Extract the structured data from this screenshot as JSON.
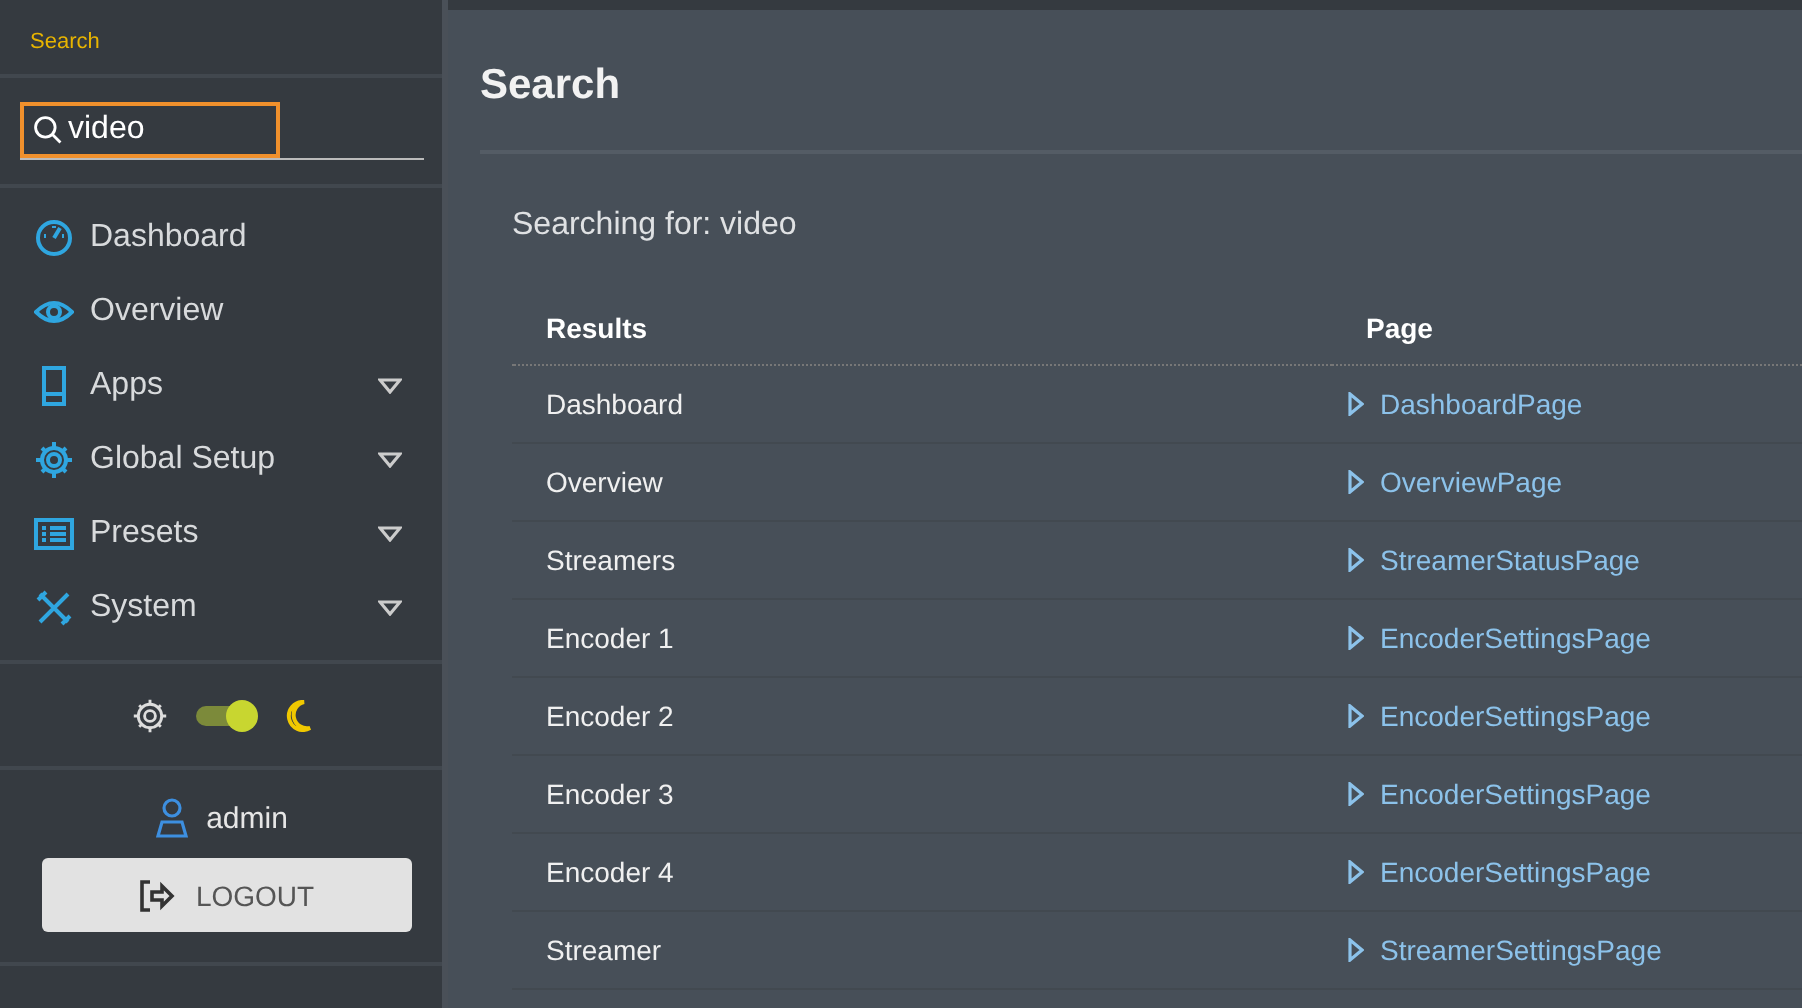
{
  "sidebar": {
    "title": "Search",
    "search": {
      "value": "video"
    },
    "nav": [
      {
        "label": "Dashboard",
        "has_submenu": false
      },
      {
        "label": "Overview",
        "has_submenu": false
      },
      {
        "label": "Apps",
        "has_submenu": true
      },
      {
        "label": "Global Setup",
        "has_submenu": true
      },
      {
        "label": "Presets",
        "has_submenu": true
      },
      {
        "label": "System",
        "has_submenu": true
      }
    ],
    "theme_toggle": {
      "on": true
    },
    "user": "admin",
    "logout": "LOGOUT"
  },
  "main": {
    "title": "Search",
    "query": "Searching for: video",
    "table": {
      "columns": [
        "Results",
        "Page"
      ],
      "rows": [
        {
          "result": "Dashboard",
          "page": "DashboardPage"
        },
        {
          "result": "Overview",
          "page": "OverviewPage"
        },
        {
          "result": "Streamers",
          "page": "StreamerStatusPage"
        },
        {
          "result": "Encoder 1",
          "page": "EncoderSettingsPage"
        },
        {
          "result": "Encoder 2",
          "page": "EncoderSettingsPage"
        },
        {
          "result": "Encoder 3",
          "page": "EncoderSettingsPage"
        },
        {
          "result": "Encoder 4",
          "page": "EncoderSettingsPage"
        },
        {
          "result": "Streamer",
          "page": "StreamerSettingsPage"
        }
      ]
    }
  }
}
